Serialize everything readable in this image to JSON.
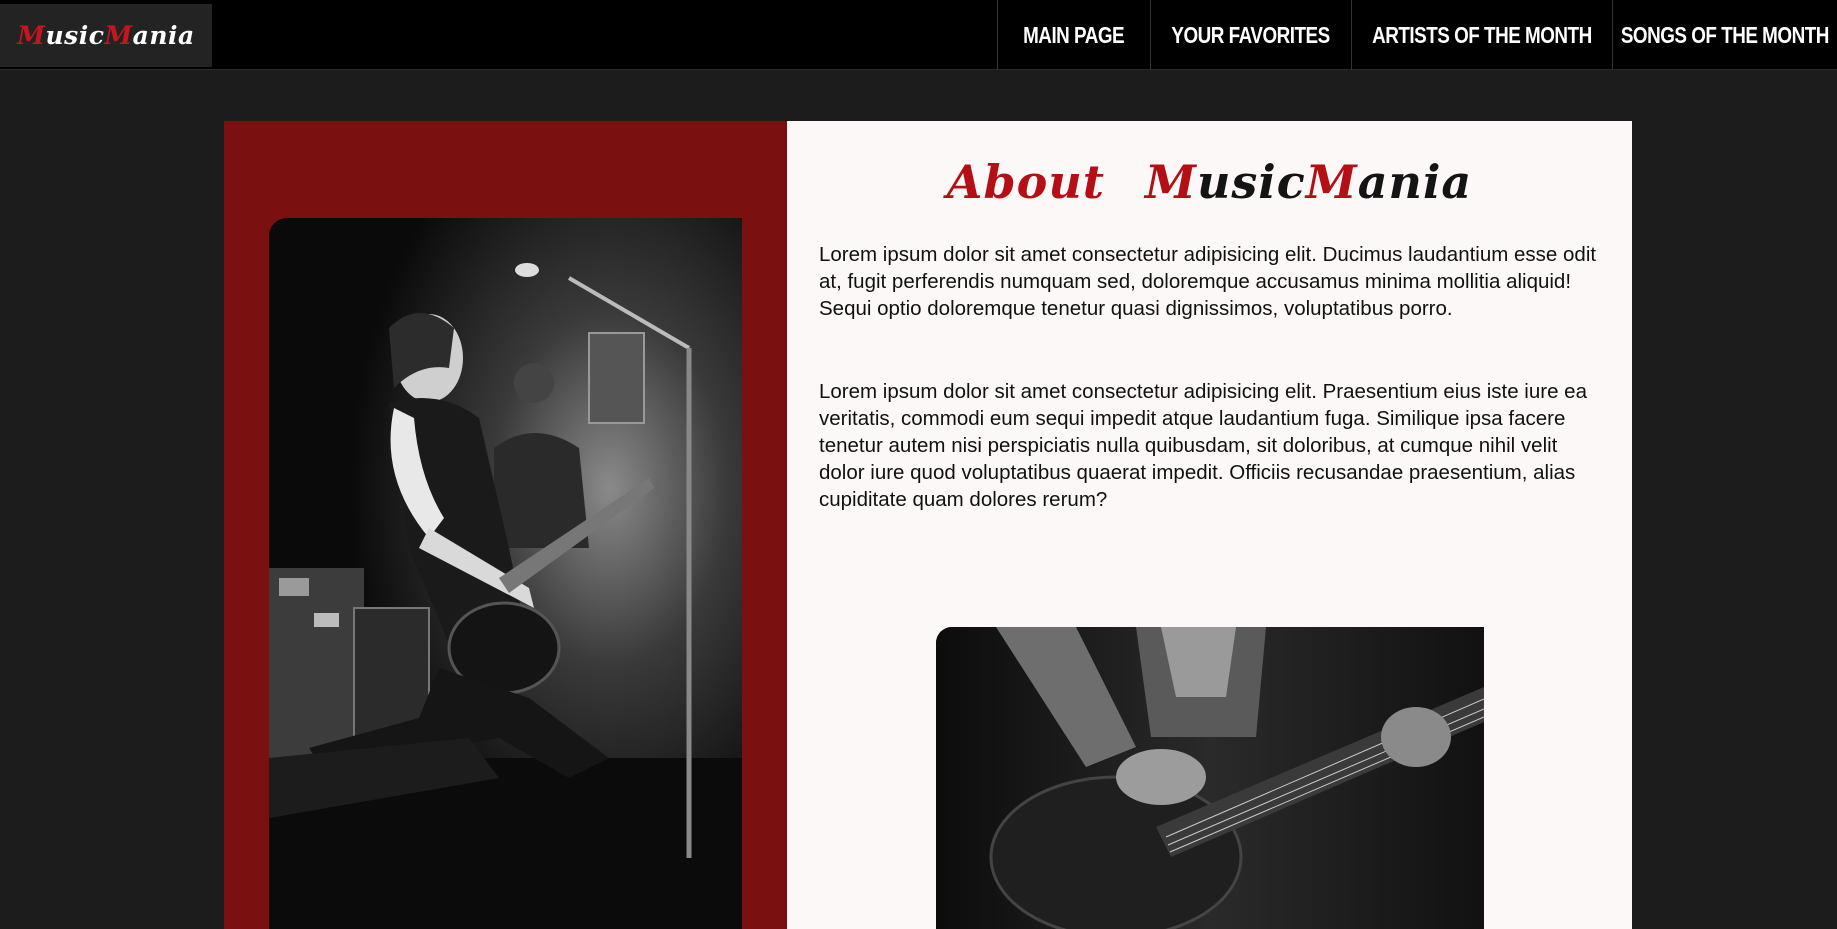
{
  "brand": {
    "part1_first": "M",
    "part1_rest": "usic",
    "part2_first": "M",
    "part2_rest": "ania"
  },
  "nav": {
    "items": [
      {
        "label": "MAIN PAGE"
      },
      {
        "label": "YOUR FAVORITES"
      },
      {
        "label": "ARTISTS OF THE MONTH"
      },
      {
        "label": "SONGS OF THE MONTH"
      }
    ]
  },
  "about": {
    "title_word": "About",
    "brand_first": "M",
    "brand_rest1": "usic",
    "brand_second": "M",
    "brand_rest2": "ania",
    "paragraph1": "Lorem ipsum dolor sit amet consectetur adipisicing elit. Ducimus laudantium esse odit at, fugit perferendis numquam sed, doloremque accusamus minima mollitia aliquid! Sequi optio doloremque tenetur quasi dignissimos, voluptatibus porro.",
    "paragraph2": "Lorem ipsum dolor sit amet consectetur adipisicing elit. Praesentium eius iste iure ea veritatis, commodi eum sequi impedit atque laudantium fuga. Similique ipsa facere tenetur autem nisi perspiciatis nulla quibusdam, sit doloribus, at cumque nihil velit dolor iure quod voluptatibus quaerat impedit. Officiis recusandae praesentium, alias cupiditate quam dolores rerum?"
  },
  "images": {
    "photo1": "guitarist-kneeling-on-stage",
    "photo2": "hands-playing-electric-guitar"
  },
  "colors": {
    "accent": "#c4161c",
    "panel_red": "#7a1010",
    "navbar": "#000000",
    "background": "#1c1c1c",
    "content_bg": "#fcf8f7"
  }
}
